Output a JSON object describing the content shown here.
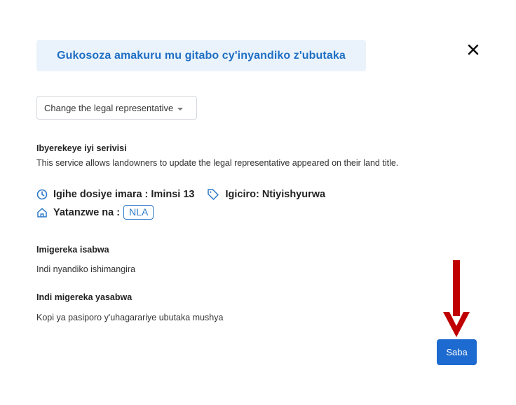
{
  "header": {
    "title": "Gukosoza amakuru mu gitabo cy'inyandiko z'ubutaka",
    "close_icon": "close-icon"
  },
  "service_select": {
    "selected": "Change the legal representative"
  },
  "about": {
    "heading": "Ibyerekeye iyi serivisi",
    "description": "This service allows landowners to update the legal representative appeared on their land title."
  },
  "meta": {
    "duration": "Igihe dosiye imara : Iminsi 13",
    "price": "Igiciro: Ntiyishyurwa",
    "provider_label": "Yatanzwe na :",
    "provider_badge": "NLA"
  },
  "requirements": {
    "heading": "Imigereka isabwa",
    "text": "Indi nyandiko ishimangira"
  },
  "other_requirements": {
    "heading": "Indi migereka yasabwa",
    "text": "Kopi ya pasiporo y'uhagarariye ubutaka mushya"
  },
  "actions": {
    "apply_label": "Saba"
  },
  "colors": {
    "accent": "#1d6ad0",
    "banner_bg": "#eaf3fb",
    "annotation_arrow": "#c00000"
  }
}
